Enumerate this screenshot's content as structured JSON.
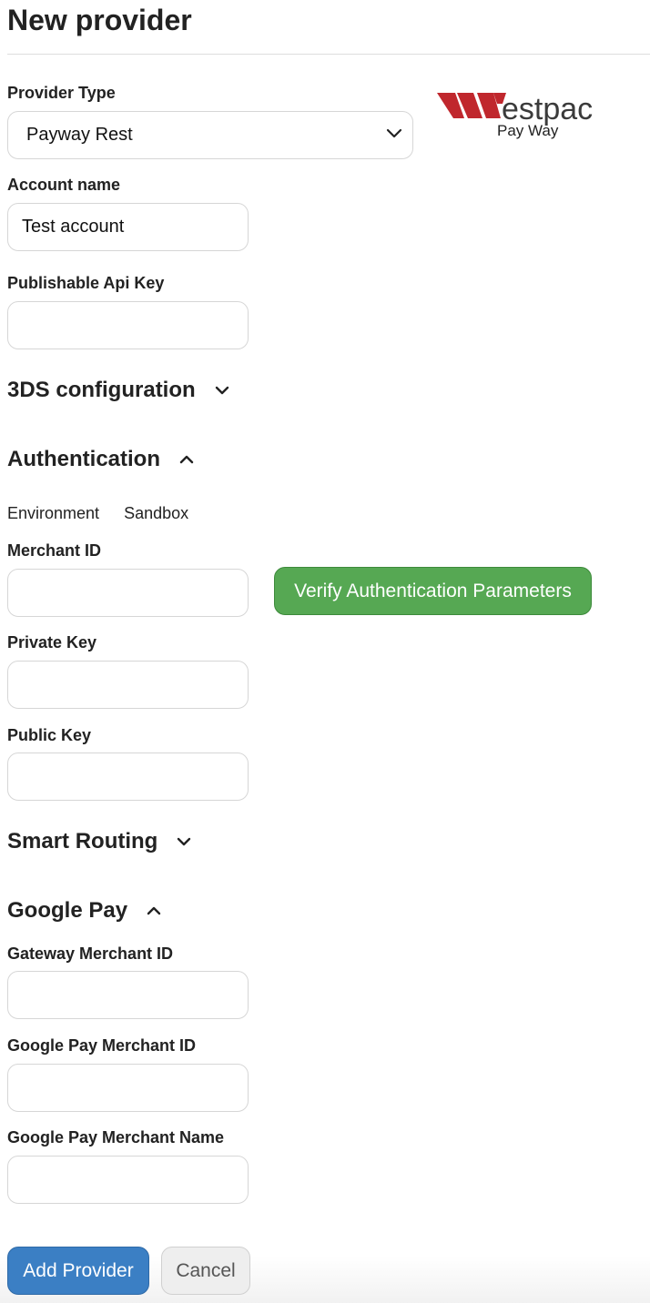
{
  "page": {
    "title": "New provider"
  },
  "provider_type": {
    "label": "Provider Type",
    "selected": "Payway Rest"
  },
  "logo": {
    "brand": "estpac",
    "sub": "Pay Way",
    "color": "#c0272d"
  },
  "account_name": {
    "label": "Account name",
    "value": "Test account"
  },
  "publishable_api_key": {
    "label": "Publishable Api Key",
    "value": ""
  },
  "sections": {
    "three_ds": {
      "title": "3DS configuration",
      "expanded": false
    },
    "authentication": {
      "title": "Authentication",
      "expanded": true
    },
    "smart_routing": {
      "title": "Smart Routing",
      "expanded": false
    },
    "google_pay": {
      "title": "Google Pay",
      "expanded": true
    }
  },
  "environment": {
    "label": "Environment",
    "value": "Sandbox"
  },
  "merchant_id": {
    "label": "Merchant ID",
    "value": ""
  },
  "verify_button": {
    "label": "Verify Authentication Parameters"
  },
  "private_key": {
    "label": "Private Key",
    "value": ""
  },
  "public_key": {
    "label": "Public Key",
    "value": ""
  },
  "gateway_merchant_id": {
    "label": "Gateway Merchant ID",
    "value": ""
  },
  "google_pay_merchant_id": {
    "label": "Google Pay Merchant ID",
    "value": ""
  },
  "google_pay_merchant_name": {
    "label": "Google Pay Merchant Name",
    "value": ""
  },
  "actions": {
    "add_label": "Add Provider",
    "cancel_label": "Cancel"
  },
  "colors": {
    "success": "#56a853",
    "primary": "#3b7fc4",
    "cancel_bg": "#eeeeee"
  }
}
